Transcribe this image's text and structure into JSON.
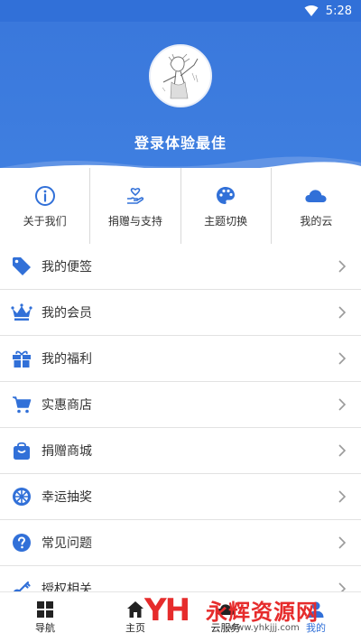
{
  "status_bar": {
    "time": "5:28"
  },
  "profile": {
    "login_prompt": "登录体验最佳"
  },
  "quick_actions": [
    {
      "label": "关于我们",
      "icon": "info-icon"
    },
    {
      "label": "捐赠与支持",
      "icon": "donate-hand-heart-icon"
    },
    {
      "label": "主题切换",
      "icon": "palette-icon"
    },
    {
      "label": "我的云",
      "icon": "cloud-icon"
    }
  ],
  "menu": [
    {
      "label": "我的便签",
      "icon": "tag-icon"
    },
    {
      "label": "我的会员",
      "icon": "crown-icon"
    },
    {
      "label": "我的福利",
      "icon": "gift-icon"
    },
    {
      "label": "实惠商店",
      "icon": "cart-icon"
    },
    {
      "label": "捐赠商城",
      "icon": "shopping-bag-icon"
    },
    {
      "label": "幸运抽奖",
      "icon": "lottery-wheel-icon"
    },
    {
      "label": "常见问题",
      "icon": "help-icon"
    },
    {
      "label": "授权相关",
      "icon": "key-icon"
    }
  ],
  "bottom_nav": [
    {
      "label": "导航",
      "icon": "grid-icon"
    },
    {
      "label": "主页",
      "icon": "home-icon"
    },
    {
      "label": "云服务",
      "icon": "cloud-service-icon"
    },
    {
      "label": "我的",
      "icon": "user-icon"
    }
  ],
  "watermark": {
    "logo": "YH",
    "title": "永辉资源网",
    "url": "www.yhkjjj.com"
  },
  "colors": {
    "primary": "#3170d8",
    "chevron": "#9a9a9a",
    "watermark": "#e62c2c"
  }
}
